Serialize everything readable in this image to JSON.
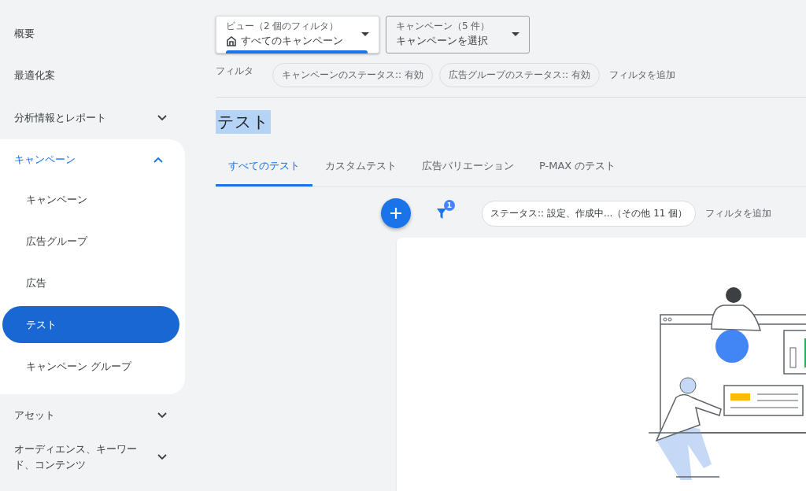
{
  "sidebar": {
    "items": [
      {
        "label": "概要"
      },
      {
        "label": "最適化案"
      },
      {
        "label": "分析情報とレポート",
        "expanded": false
      },
      {
        "label": "キャンペーン",
        "expanded": true,
        "children": [
          {
            "label": "キャンペーン",
            "selected": false
          },
          {
            "label": "広告グループ",
            "selected": false
          },
          {
            "label": "広告",
            "selected": false
          },
          {
            "label": "テスト",
            "selected": true
          },
          {
            "label": "キャンペーン グループ",
            "selected": false
          }
        ]
      },
      {
        "label": "アセット",
        "expanded": false
      },
      {
        "label": "オーディエンス、キーワード、コンテンツ",
        "expanded": false
      }
    ]
  },
  "view_selector": {
    "label": "ビュー（2 個のフィルタ）",
    "value": "すべてのキャンペーン"
  },
  "campaign_selector": {
    "label": "キャンペーン（5 件）",
    "value": "キャンペーンを選択"
  },
  "filters": {
    "label": "フィルタ",
    "chips": [
      "キャンペーンのステータス:: 有効",
      "広告グループのステータス:: 有効"
    ],
    "add": "フィルタを追加"
  },
  "page_title": "テスト",
  "tabs": [
    {
      "label": "すべてのテスト",
      "selected": true
    },
    {
      "label": "カスタムテスト",
      "selected": false
    },
    {
      "label": "広告バリエーション",
      "selected": false
    },
    {
      "label": "P-MAX のテスト",
      "selected": false
    }
  ],
  "toolbar": {
    "filter_badge": "1",
    "status_chip": "ステータス:: 設定、作成中...（その他 11 個）",
    "add_filter": "フィルタを追加"
  }
}
